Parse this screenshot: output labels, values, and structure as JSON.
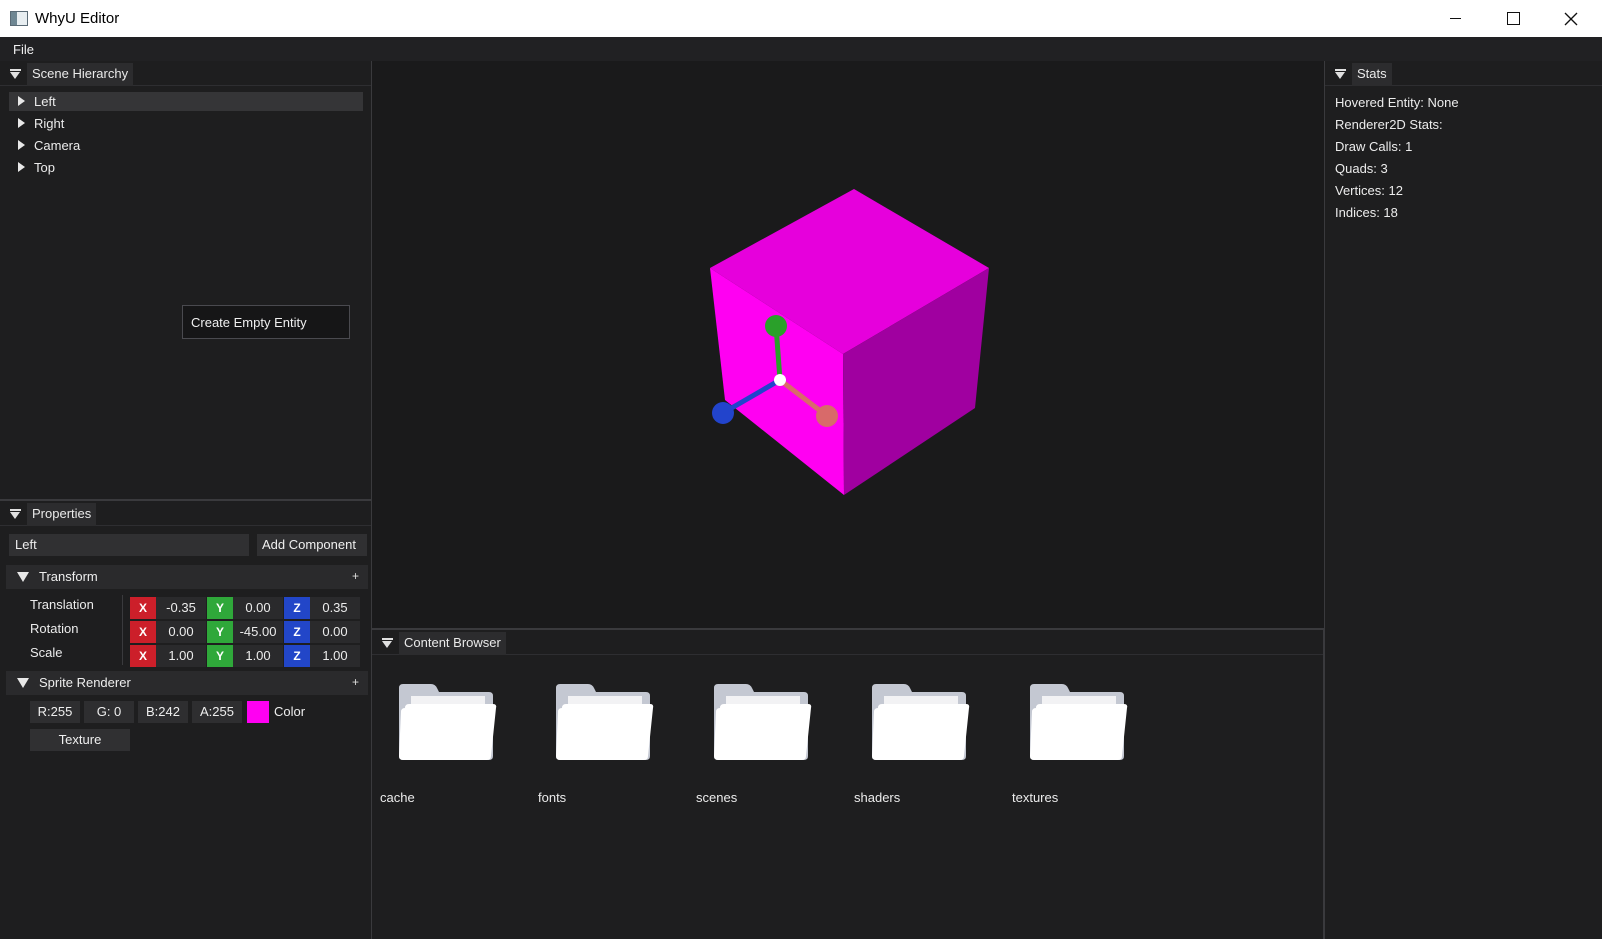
{
  "window": {
    "title": "WhyU Editor",
    "app_icon": "window-app-icon"
  },
  "menu": {
    "items": [
      "File"
    ]
  },
  "scene_hierarchy": {
    "title": "Scene Hierarchy",
    "entities": [
      {
        "label": "Left",
        "selected": true
      },
      {
        "label": "Right",
        "selected": false
      },
      {
        "label": "Camera",
        "selected": false
      },
      {
        "label": "Top",
        "selected": false
      }
    ],
    "context_menu": {
      "item": "Create Empty Entity"
    }
  },
  "properties": {
    "title": "Properties",
    "entity_name": "Left",
    "add_component_label": "Add Component",
    "transform": {
      "title": "Transform",
      "plus": "+",
      "rows": [
        {
          "label": "Translation",
          "x": "-0.35",
          "y": "0.00",
          "z": "0.35"
        },
        {
          "label": "Rotation",
          "x": "0.00",
          "y": "-45.00",
          "z": "0.00"
        },
        {
          "label": "Scale",
          "x": "1.00",
          "y": "1.00",
          "z": "1.00"
        }
      ],
      "axis_labels": {
        "x": "X",
        "y": "Y",
        "z": "Z"
      }
    },
    "sprite_renderer": {
      "title": "Sprite Renderer",
      "plus": "+",
      "r": "R:255",
      "g": "G:  0",
      "b": "B:242",
      "a": "A:255",
      "color_label": "Color",
      "color_hex": "#ff00f2",
      "texture_label": "Texture"
    }
  },
  "viewport": {
    "cube_color": "#ff00f2",
    "gizmo_colors": {
      "x": "#d86a6a",
      "y": "#2aa02a",
      "z": "#2244cc"
    }
  },
  "content_browser": {
    "title": "Content Browser",
    "folders": [
      "cache",
      "fonts",
      "scenes",
      "shaders",
      "textures"
    ]
  },
  "stats": {
    "title": "Stats",
    "lines": [
      "Hovered Entity: None",
      "Renderer2D Stats:",
      "Draw Calls: 1",
      "Quads: 3",
      "Vertices: 12",
      "Indices: 18"
    ]
  }
}
